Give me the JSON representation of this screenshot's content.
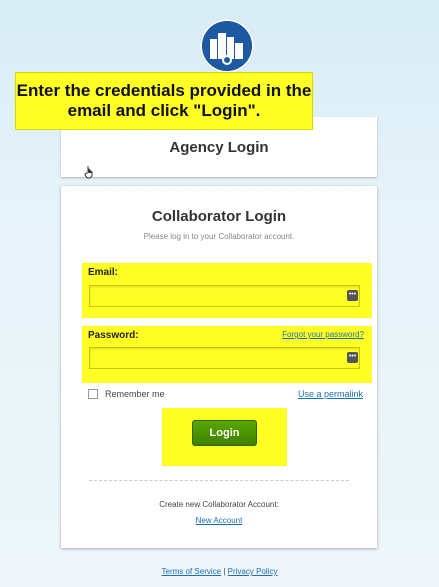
{
  "instruction": "Enter the credentials provided in the email and click \"Login\".",
  "agency": {
    "title": "Agency Login"
  },
  "collaborator": {
    "title": "Collaborator Login",
    "subtitle": "Please log in to your Collaborator account.",
    "email_label": "Email:",
    "email_value": "",
    "password_label": "Password:",
    "password_value": "",
    "forgot_link": "Forgot your password?",
    "remember_label": "Remember me",
    "permalink": "Use a permalink",
    "login_button": "Login",
    "create_text": "Create new Collaborator Account:",
    "new_account_link": "New Account"
  },
  "footer": {
    "terms": "Terms of Service",
    "separator": "|",
    "privacy": "Privacy Policy"
  },
  "icons": {
    "logo": "city-logo-icon",
    "cursor": "hand-pointer-icon",
    "key": "password-manager-key-icon"
  },
  "colors": {
    "highlight": "#ffff26",
    "brand_blue": "#1d5aa1",
    "login_green": "#3f8000",
    "link": "#1f6fb3"
  }
}
